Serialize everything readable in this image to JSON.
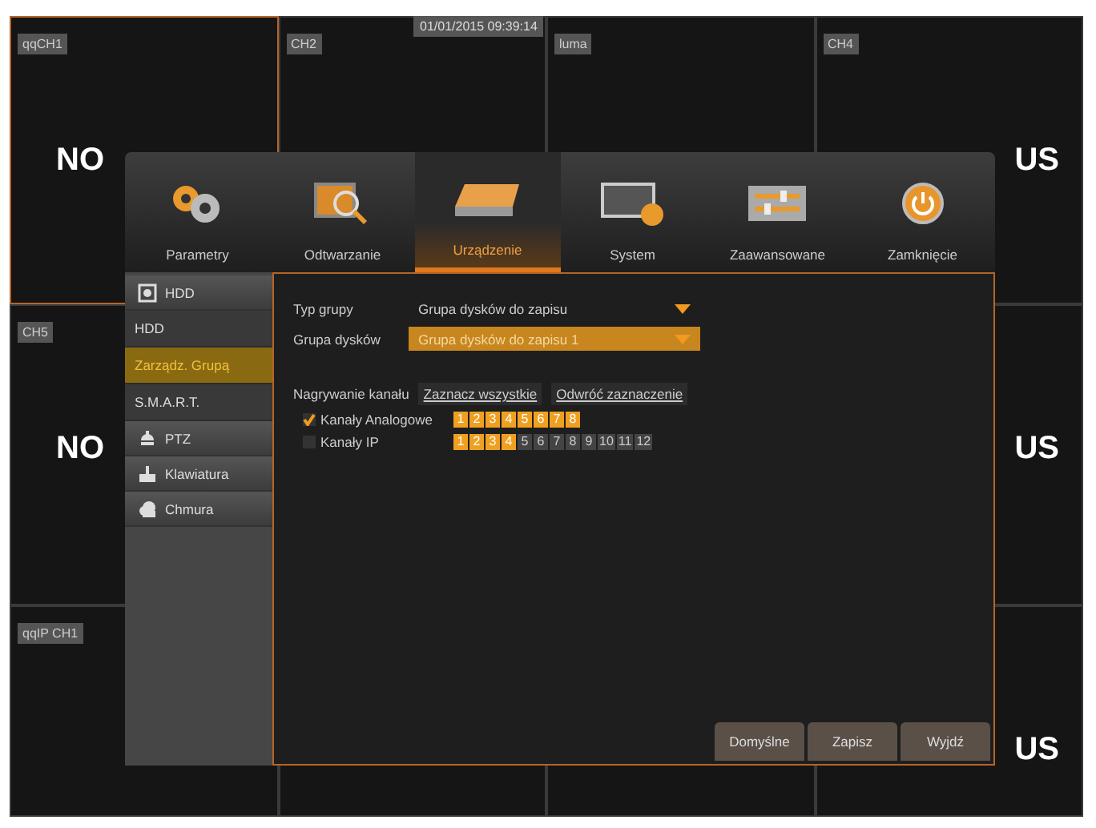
{
  "camera_grid": {
    "datetime": "01/01/2015 09:39:14",
    "tiles": [
      {
        "label": "qqCH1",
        "selected": true,
        "logo_left": "NO"
      },
      {
        "label": "CH2",
        "selected": false
      },
      {
        "label": "luma",
        "selected": false
      },
      {
        "label": "CH4",
        "selected": false,
        "logo_right": "US"
      },
      {
        "label": "CH5",
        "selected": false,
        "logo_left": "NO"
      },
      {
        "selected": false,
        "logo_right": "US"
      },
      {
        "label": "qqIP CH1",
        "selected": false
      },
      {
        "selected": false
      },
      {
        "selected": false
      },
      {
        "selected": false,
        "logo_right": "US"
      }
    ]
  },
  "menu": {
    "tabs": [
      {
        "label": "Parametry",
        "selected": false
      },
      {
        "label": "Odtwarzanie",
        "selected": false
      },
      {
        "label": "Urządzenie",
        "selected": true
      },
      {
        "label": "System",
        "selected": false
      },
      {
        "label": "Zaawansowane",
        "selected": false
      },
      {
        "label": "Zamknięcie",
        "selected": false
      }
    ],
    "sidebar": {
      "items": [
        {
          "label": "HDD",
          "kind": "header",
          "selected": false,
          "children": [
            {
              "label": "HDD",
              "selected": false
            },
            {
              "label": "Zarządz. Grupą",
              "selected": true
            },
            {
              "label": "S.M.A.R.T.",
              "selected": false
            }
          ]
        },
        {
          "label": "PTZ",
          "kind": "header",
          "selected": false
        },
        {
          "label": "Klawiatura",
          "kind": "header",
          "selected": false
        },
        {
          "label": "Chmura",
          "kind": "header",
          "selected": false
        }
      ]
    },
    "form": {
      "fields": [
        {
          "label": "Typ grupy",
          "value": "Grupa dysków do zapisu",
          "highlighted": false
        },
        {
          "label": "Grupa dysków",
          "value": "Grupa dysków do zapisu 1",
          "highlighted": true
        }
      ],
      "recording": {
        "label": "Nagrywanie kanału",
        "buttons": [
          "Zaznacz wszystkie",
          "Odwróć zaznaczenie"
        ],
        "groups": [
          {
            "label": "Kanały Analogowe",
            "checked": true,
            "channels": [
              {
                "number": "1",
                "selected": true
              },
              {
                "number": "2",
                "selected": true
              },
              {
                "number": "3",
                "selected": true
              },
              {
                "number": "4",
                "selected": true
              },
              {
                "number": "5",
                "selected": true
              },
              {
                "number": "6",
                "selected": true
              },
              {
                "number": "7",
                "selected": true
              },
              {
                "number": "8",
                "selected": true
              }
            ]
          },
          {
            "label": "Kanały IP",
            "checked": false,
            "channels": [
              {
                "number": "1",
                "selected": true
              },
              {
                "number": "2",
                "selected": true
              },
              {
                "number": "3",
                "selected": true
              },
              {
                "number": "4",
                "selected": true
              },
              {
                "number": "5",
                "selected": false
              },
              {
                "number": "6",
                "selected": false
              },
              {
                "number": "7",
                "selected": false
              },
              {
                "number": "8",
                "selected": false
              },
              {
                "number": "9",
                "selected": false
              },
              {
                "number": "10",
                "selected": false
              },
              {
                "number": "11",
                "selected": false
              },
              {
                "number": "12",
                "selected": false
              }
            ]
          }
        ]
      }
    },
    "buttons": [
      "Domyślne",
      "Zapisz",
      "Wyjdź"
    ]
  }
}
